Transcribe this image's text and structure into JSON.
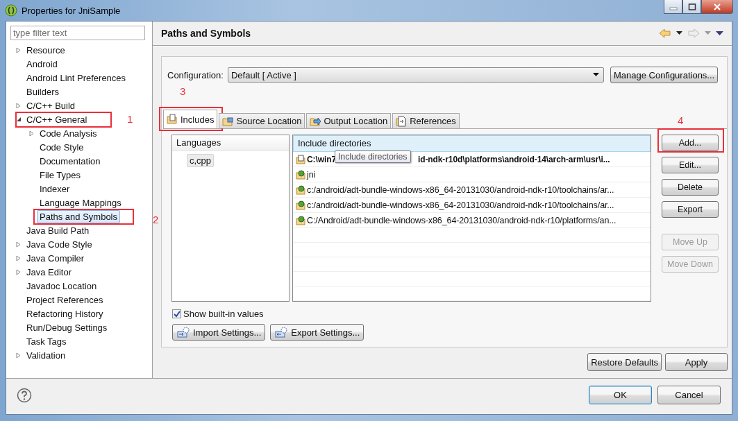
{
  "window": {
    "title": "Properties for JniSample"
  },
  "filter": {
    "placeholder": "type filter text"
  },
  "tree": [
    {
      "label": "Resource",
      "expanded": false,
      "selected": false
    },
    {
      "label": "Android",
      "selected": false
    },
    {
      "label": "Android Lint Preferences",
      "selected": false
    },
    {
      "label": "Builders",
      "selected": false
    },
    {
      "label": "C/C++ Build",
      "expanded": false,
      "selected": false
    },
    {
      "label": "C/C++ General",
      "expanded": true,
      "selected": false,
      "callout": "1",
      "children": [
        {
          "label": "Code Analysis",
          "expanded": false,
          "selected": false
        },
        {
          "label": "Code Style",
          "selected": false
        },
        {
          "label": "Documentation",
          "selected": false
        },
        {
          "label": "File Types",
          "selected": false
        },
        {
          "label": "Indexer",
          "selected": false
        },
        {
          "label": "Language Mappings",
          "selected": false
        },
        {
          "label": "Paths and Symbols",
          "selected": true,
          "callout": "2"
        }
      ]
    },
    {
      "label": "Java Build Path",
      "selected": false
    },
    {
      "label": "Java Code Style",
      "expanded": false,
      "selected": false
    },
    {
      "label": "Java Compiler",
      "expanded": false,
      "selected": false
    },
    {
      "label": "Java Editor",
      "expanded": false,
      "selected": false
    },
    {
      "label": "Javadoc Location",
      "selected": false
    },
    {
      "label": "Project References",
      "selected": false
    },
    {
      "label": "Refactoring History",
      "selected": false
    },
    {
      "label": "Run/Debug Settings",
      "selected": false
    },
    {
      "label": "Task Tags",
      "selected": false
    },
    {
      "label": "Validation",
      "expanded": false,
      "selected": false
    }
  ],
  "page": {
    "title": "Paths and Symbols"
  },
  "configuration": {
    "label": "Configuration:",
    "value": "Default  [ Active ]",
    "manage_button": "Manage Configurations..."
  },
  "tabs": [
    {
      "label": "Includes",
      "kind": "includes",
      "selected": true,
      "callout": "3"
    },
    {
      "label": "Source Location",
      "kind": "source",
      "selected": false
    },
    {
      "label": "Output Location",
      "kind": "output",
      "selected": false
    },
    {
      "label": "References",
      "kind": "references",
      "selected": false
    }
  ],
  "languages": {
    "header": "Languages",
    "items": [
      {
        "label": "c,cpp",
        "selected": true
      }
    ]
  },
  "include_directories": {
    "header": "Include directories",
    "tooltip": "Include directories",
    "rows": [
      {
        "kind": "builtin",
        "segments": [
          "C:\\win7",
          "id-ndk-r10d\\platforms\\android-14\\arch-arm\\usr\\i..."
        ]
      },
      {
        "kind": "workspace",
        "segments": [
          "jni"
        ]
      },
      {
        "kind": "workspace",
        "segments": [
          "c:/android/adt-bundle-windows-x86_64-20131030/android-ndk-r10/toolchains/ar..."
        ]
      },
      {
        "kind": "workspace",
        "segments": [
          "c:/android/adt-bundle-windows-x86_64-20131030/android-ndk-r10/toolchains/ar..."
        ]
      },
      {
        "kind": "workspace",
        "segments": [
          "C:/Android/adt-bundle-windows-x86_64-20131030/android-ndk-r10/platforms/an..."
        ]
      }
    ]
  },
  "list_buttons": [
    {
      "label": "Add...",
      "disabled": false,
      "callout": "4"
    },
    {
      "label": "Edit...",
      "disabled": false
    },
    {
      "label": "Delete",
      "disabled": false
    },
    {
      "label": "Export",
      "disabled": false
    },
    {
      "label": "Move Up",
      "disabled": true
    },
    {
      "label": "Move Down",
      "disabled": true
    }
  ],
  "show_builtin": {
    "label": "Show built-in values",
    "checked": true
  },
  "settings_buttons": [
    {
      "label": "Import Settings...",
      "kind": "import"
    },
    {
      "label": "Export Settings...",
      "kind": "export"
    }
  ],
  "page_buttons": [
    "Restore Defaults",
    "Apply"
  ],
  "dialog_buttons": [
    {
      "label": "OK",
      "default": true
    },
    {
      "label": "Cancel",
      "default": false
    }
  ]
}
